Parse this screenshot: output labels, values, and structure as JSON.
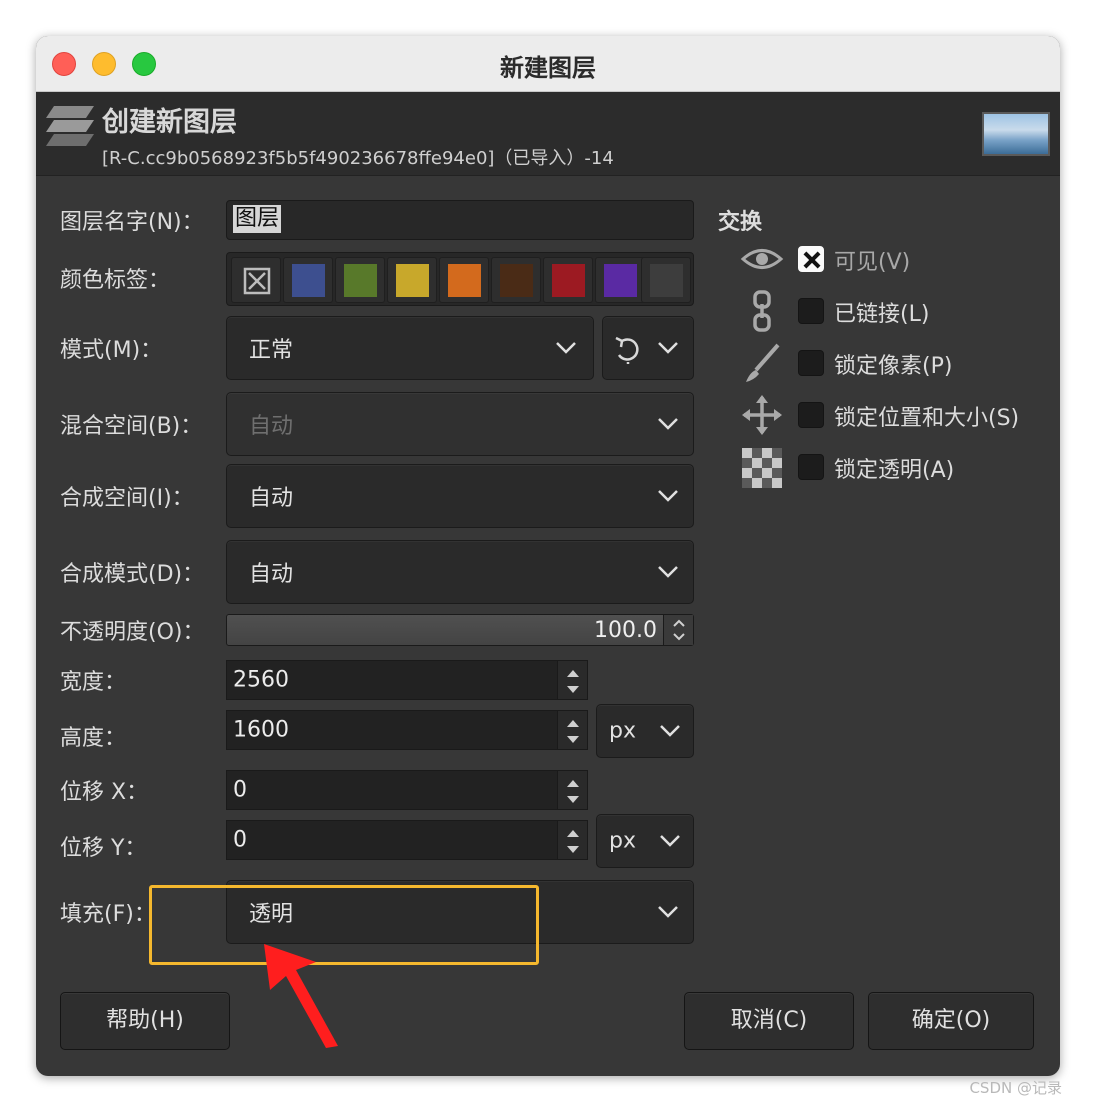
{
  "window": {
    "title": "新建图层"
  },
  "header": {
    "title": "创建新图层",
    "subtitle": "[R-C.cc9b0568923f5b5f490236678ffe94e0]（已导入）-14",
    "thumbnail_icon": "image-thumbnail"
  },
  "form": {
    "layer_name": {
      "label": "图层名字(N)：",
      "value": "图层"
    },
    "color_tag": {
      "label": "颜色标签：",
      "swatches": [
        {
          "name": "none",
          "color": "#2e2e2e"
        },
        {
          "name": "blue",
          "color": "#3d4f8f"
        },
        {
          "name": "green",
          "color": "#58792a"
        },
        {
          "name": "yellow",
          "color": "#c8a82b"
        },
        {
          "name": "orange",
          "color": "#d36a1d"
        },
        {
          "name": "brown",
          "color": "#4a2b16"
        },
        {
          "name": "red",
          "color": "#9c1a22"
        },
        {
          "name": "violet",
          "color": "#5a2aa3"
        },
        {
          "name": "gray",
          "color": "#3d3d3d"
        }
      ]
    },
    "mode": {
      "label": "模式(M)：",
      "value": "正常"
    },
    "blend_space": {
      "label": "混合空间(B)：",
      "value": "自动"
    },
    "composite_space": {
      "label": "合成空间(I)：",
      "value": "自动"
    },
    "composite_mode": {
      "label": "合成模式(D)：",
      "value": "自动"
    },
    "opacity": {
      "label": "不透明度(O)：",
      "value": "100.0"
    },
    "width": {
      "label": "宽度：",
      "value": "2560"
    },
    "height": {
      "label": "高度：",
      "value": "1600"
    },
    "size_unit": "px",
    "offset_x": {
      "label": "位移 X：",
      "value": "0"
    },
    "offset_y": {
      "label": "位移 Y：",
      "value": "0"
    },
    "offset_unit": "px",
    "fill": {
      "label": "填充(F)：",
      "value": "透明"
    }
  },
  "switches": {
    "title": "交换",
    "items": [
      {
        "icon": "eye-icon",
        "label": "可见(V)",
        "checked": true
      },
      {
        "icon": "chain-icon",
        "label": "已链接(L)",
        "checked": false
      },
      {
        "icon": "brush-icon",
        "label": "锁定像素(P)",
        "checked": false
      },
      {
        "icon": "move-icon",
        "label": "锁定位置和大小(S)",
        "checked": false
      },
      {
        "icon": "checkerboard-icon",
        "label": "锁定透明(A)",
        "checked": false
      }
    ]
  },
  "buttons": {
    "help": "帮助(H)",
    "cancel": "取消(C)",
    "ok": "确定(O)"
  },
  "watermark": "CSDN @记录"
}
